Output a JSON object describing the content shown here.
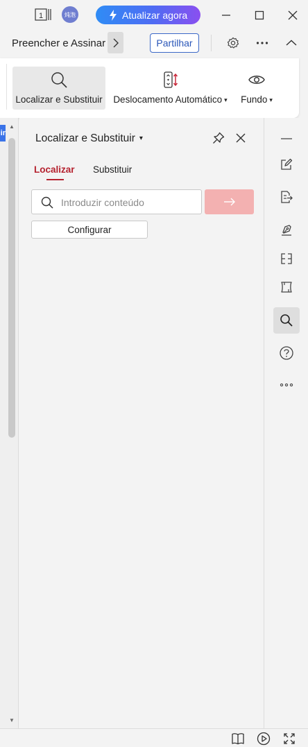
{
  "titlebar": {
    "page_count": "1",
    "avatar_text": "炖泡",
    "upgrade_label": "Atualizar agora"
  },
  "toolbar": {
    "doc_title": "Preencher e Assinar",
    "share_label": "Partilhar"
  },
  "ribbon": {
    "items": [
      {
        "label": "Localizar e Substituir",
        "icon": "search-icon",
        "active": true
      },
      {
        "label": "Deslocamento Automático",
        "icon": "auto-scroll-icon",
        "dropdown": true
      },
      {
        "label": "Fundo",
        "icon": "eye-icon",
        "dropdown": true
      }
    ]
  },
  "left_strip": {
    "tab_text": "ir"
  },
  "panel": {
    "title": "Localizar e Substituir",
    "tabs": [
      {
        "label": "Localizar",
        "active": true
      },
      {
        "label": "Substituir",
        "active": false
      }
    ],
    "search_placeholder": "Introduzir conteúdo",
    "search_value": "",
    "config_label": "Configurar"
  },
  "rail": {
    "items": [
      "minimize-line-icon",
      "edit-icon",
      "export-doc-icon",
      "sign-pen-icon",
      "compare-icon",
      "scroll-icon",
      "search-icon",
      "help-icon",
      "more-icon"
    ],
    "active": "search-icon"
  },
  "colors": {
    "accent_red": "#b5222f",
    "go_button": "#f3b1b1",
    "share_blue": "#2a56b8",
    "upgrade_gradient_start": "#2f8cf5",
    "upgrade_gradient_end": "#8a4ff0"
  }
}
